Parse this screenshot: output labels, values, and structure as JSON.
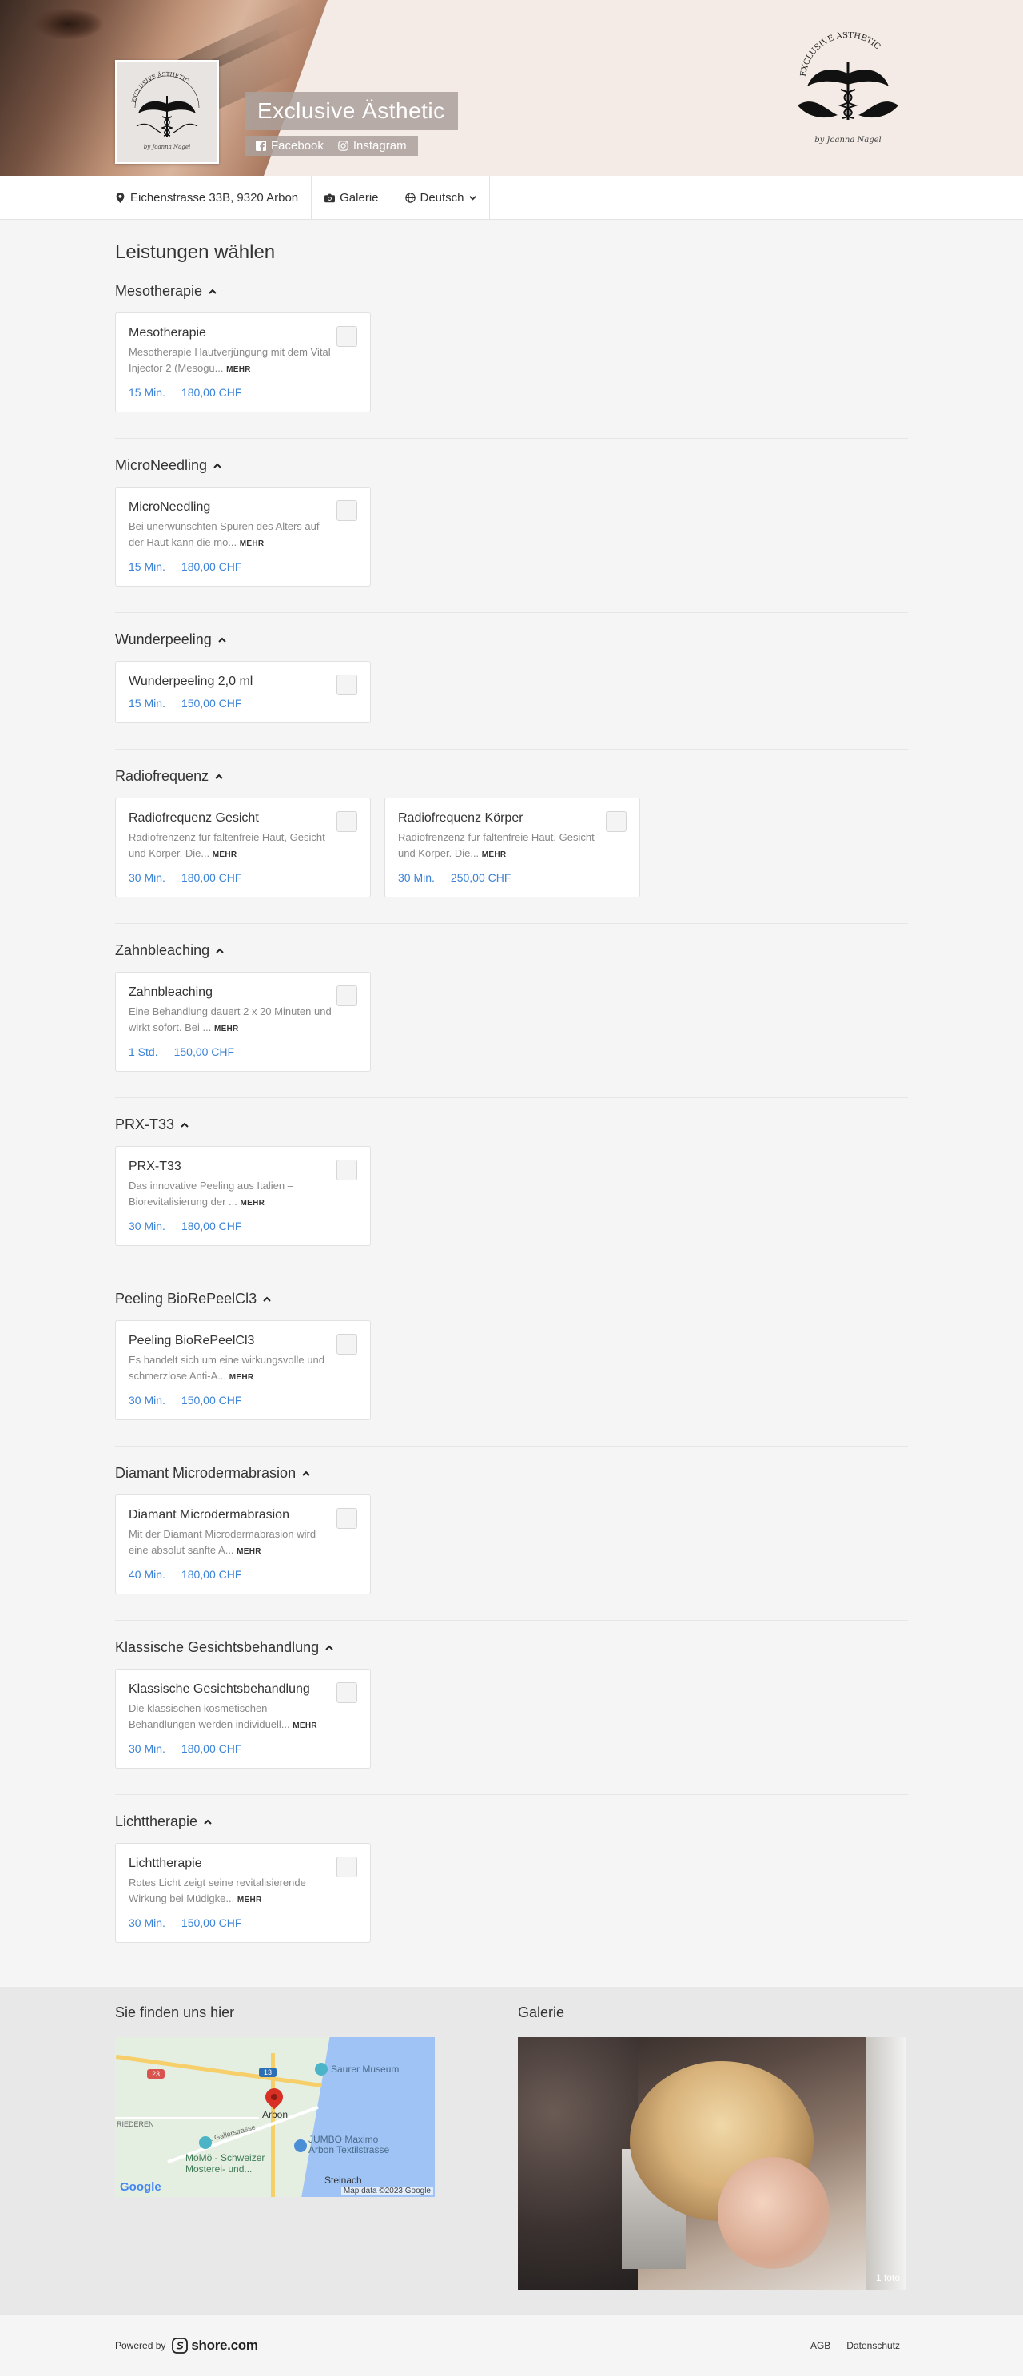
{
  "business": {
    "name": "Exclusive Ästhetic",
    "logo_text": "EXCLUSIVE ÄSTHETIC",
    "logo_signature": "by Joanna Nagel",
    "social": [
      {
        "label": "Facebook",
        "icon": "facebook-icon"
      },
      {
        "label": "Instagram",
        "icon": "instagram-icon"
      }
    ]
  },
  "nav": {
    "address": "Eichenstrasse 33B, 9320 Arbon",
    "gallery": "Galerie",
    "language": "Deutsch"
  },
  "page_title": "Leistungen wählen",
  "more_label": "MEHR",
  "categories": [
    {
      "title": "Mesotherapie",
      "services": [
        {
          "name": "Mesotherapie",
          "desc": "Mesotherapie Hautverjüngung mit dem Vital Injector 2 (Mesogu...",
          "duration": "15 Min.",
          "price": "180,00 CHF"
        }
      ]
    },
    {
      "title": "MicroNeedling",
      "services": [
        {
          "name": "MicroNeedling",
          "desc": "Bei unerwünschten Spuren des Alters auf der Haut kann die mo...",
          "duration": "15 Min.",
          "price": "180,00 CHF"
        }
      ]
    },
    {
      "title": "Wunderpeeling",
      "services": [
        {
          "name": "Wunderpeeling 2,0 ml",
          "desc": "",
          "duration": "15 Min.",
          "price": "150,00 CHF"
        }
      ]
    },
    {
      "title": "Radiofrequenz",
      "services": [
        {
          "name": "Radiofrequenz Gesicht",
          "desc": "Radiofrenzenz für faltenfreie Haut, Gesicht und Körper. Die...",
          "duration": "30 Min.",
          "price": "180,00 CHF"
        },
        {
          "name": "Radiofrequenz Körper",
          "desc": "Radiofrenzenz für faltenfreie Haut, Gesicht und Körper. Die...",
          "duration": "30 Min.",
          "price": "250,00 CHF"
        }
      ]
    },
    {
      "title": "Zahnbleaching",
      "services": [
        {
          "name": "Zahnbleaching",
          "desc": "Eine Behandlung dauert 2 x 20 Minuten und wirkt sofort. Bei ...",
          "duration": "1 Std.",
          "price": "150,00 CHF"
        }
      ]
    },
    {
      "title": "PRX-T33",
      "services": [
        {
          "name": "PRX-T33",
          "desc": "Das innovative Peeling aus Italien – Biorevitalisierung der ...",
          "duration": "30 Min.",
          "price": "180,00 CHF"
        }
      ]
    },
    {
      "title": "Peeling BioRePeelCl3",
      "services": [
        {
          "name": "Peeling BioRePeelCl3",
          "desc": "Es handelt sich um eine wirkungsvolle und schmerzlose Anti-A...",
          "duration": "30 Min.",
          "price": "150,00 CHF"
        }
      ]
    },
    {
      "title": "Diamant Microdermabrasion",
      "services": [
        {
          "name": "Diamant Microdermabrasion",
          "desc": "Mit der Diamant Microdermabrasion wird eine absolut sanfte A...",
          "duration": "40 Min.",
          "price": "180,00 CHF"
        }
      ]
    },
    {
      "title": "Klassische Gesichtsbehandlung",
      "services": [
        {
          "name": "Klassische Gesichtsbehandlung",
          "desc": "Die klassischen kosmetischen Behandlungen werden individuell...",
          "duration": "30 Min.",
          "price": "180,00 CHF"
        }
      ]
    },
    {
      "title": "Lichttherapie",
      "services": [
        {
          "name": "Lichttherapie",
          "desc": "Rotes Licht zeigt seine revitalisierende Wirkung bei Müdigke...",
          "duration": "30 Min.",
          "price": "150,00 CHF"
        }
      ]
    }
  ],
  "info": {
    "map_title": "Sie finden uns hier",
    "gallery_title": "Galerie",
    "map_labels": {
      "saurer": "Saurer Museum",
      "arbon": "Arbon",
      "riederen": "RIEDEREN",
      "momo": "MoMö - Schweizer Mosterei- und...",
      "jumbo": "JUMBO Maximo Arbon Textilstrasse",
      "steinach": "Steinach",
      "st_gallerstrasse": "St. Gallerstrasse",
      "road_a": "23",
      "road_b": "13",
      "google": "Google",
      "credit": "Map data ©2023 Google"
    },
    "gallery_count": "1 foto"
  },
  "footer": {
    "powered_by": "Powered by",
    "brand": "shore.com",
    "links": [
      "AGB",
      "Datenschutz"
    ]
  },
  "colors": {
    "accent": "#3b82d6",
    "hero_bg": "#f4ebe6"
  }
}
